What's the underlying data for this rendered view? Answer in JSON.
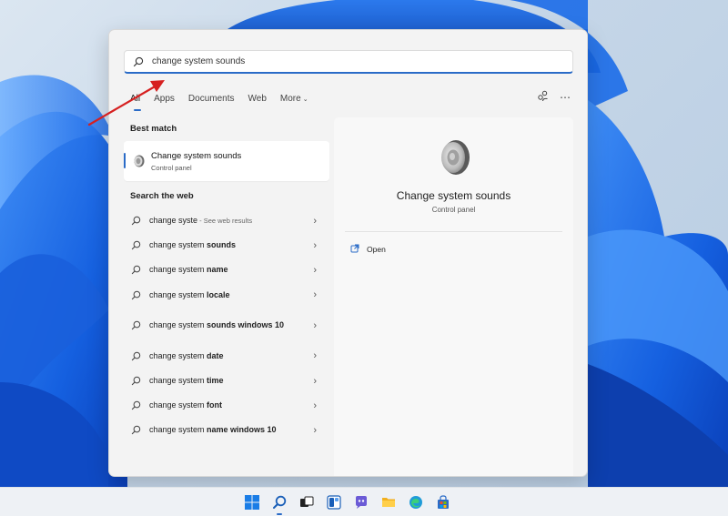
{
  "search": {
    "query": "change system sounds",
    "placeholder": ""
  },
  "tabs": [
    {
      "label": "All"
    },
    {
      "label": "Apps"
    },
    {
      "label": "Documents"
    },
    {
      "label": "Web"
    },
    {
      "label": "More"
    }
  ],
  "tools": {
    "share_icon": "people-share-icon",
    "more_icon": "ellipsis-icon"
  },
  "best_match": {
    "section_title": "Best match",
    "title": "Change system sounds",
    "subtitle": "Control panel"
  },
  "web": {
    "section_title": "Search the web",
    "items": [
      {
        "text": "change syste",
        "hint": " - See web results"
      },
      {
        "prefix": "change system ",
        "bold": "sounds"
      },
      {
        "prefix": "change system ",
        "bold": "name"
      },
      {
        "prefix": "change system ",
        "bold": "locale"
      },
      {
        "prefix": "change system ",
        "bold": "sounds windows 10"
      },
      {
        "prefix": "change system ",
        "bold": "date"
      },
      {
        "prefix": "change system ",
        "bold": "time"
      },
      {
        "prefix": "change system ",
        "bold": "font"
      },
      {
        "prefix": "change system ",
        "bold": "name windows 10"
      }
    ]
  },
  "detail": {
    "title": "Change system sounds",
    "subtitle": "Control panel",
    "action": "Open"
  },
  "colors": {
    "accent": "#2a6bc7",
    "annotation_arrow": "#d62020"
  }
}
